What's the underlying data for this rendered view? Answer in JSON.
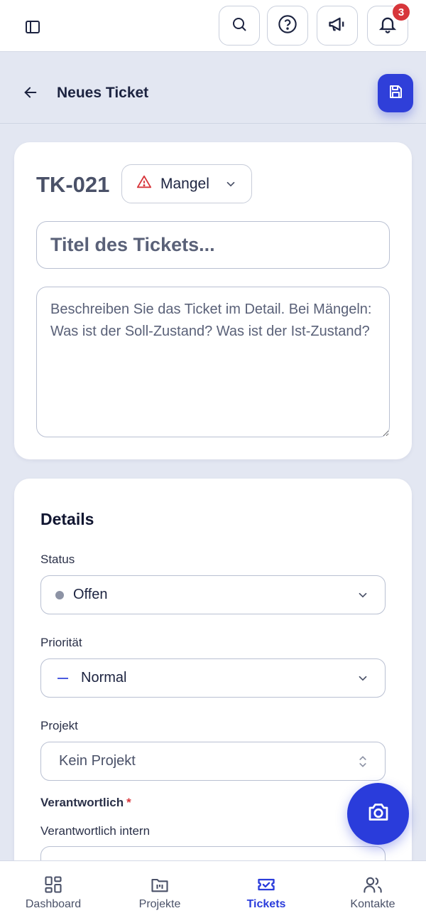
{
  "topbar": {
    "icons": [
      "sidebar-icon",
      "search-icon",
      "help-icon",
      "megaphone-icon",
      "bell-icon"
    ],
    "notification_count": "3"
  },
  "page": {
    "title": "Neues Ticket",
    "back_icon": "arrow-left-icon",
    "save_icon": "save-icon"
  },
  "ticket": {
    "id": "TK-021",
    "type": "Mangel",
    "type_icon": "warning-icon",
    "title_placeholder": "Titel des Tickets...",
    "description_placeholder": "Beschreiben Sie das Ticket im Detail. Bei Mängeln: Was ist der Soll-Zustand? Was ist der Ist-Zustand?"
  },
  "details": {
    "heading": "Details",
    "status_label": "Status",
    "status_value": "Offen",
    "priority_label": "Priorität",
    "priority_value": "Normal",
    "project_label": "Projekt",
    "project_value": "Kein Projekt",
    "responsible_label": "Verantwortlich",
    "required_marker": "*",
    "responsible_internal_label": "Verantwortlich intern"
  },
  "fab": {
    "icon": "camera-icon"
  },
  "bottom_nav": {
    "items": [
      {
        "label": "Dashboard",
        "icon": "dashboard-icon"
      },
      {
        "label": "Projekte",
        "icon": "folder-icon"
      },
      {
        "label": "Tickets",
        "icon": "ticket-icon",
        "active": true
      },
      {
        "label": "Kontakte",
        "icon": "users-icon"
      }
    ]
  },
  "colors": {
    "accent": "#2a3cdb",
    "badge": "#d7363b",
    "background": "#e3e7f2"
  }
}
